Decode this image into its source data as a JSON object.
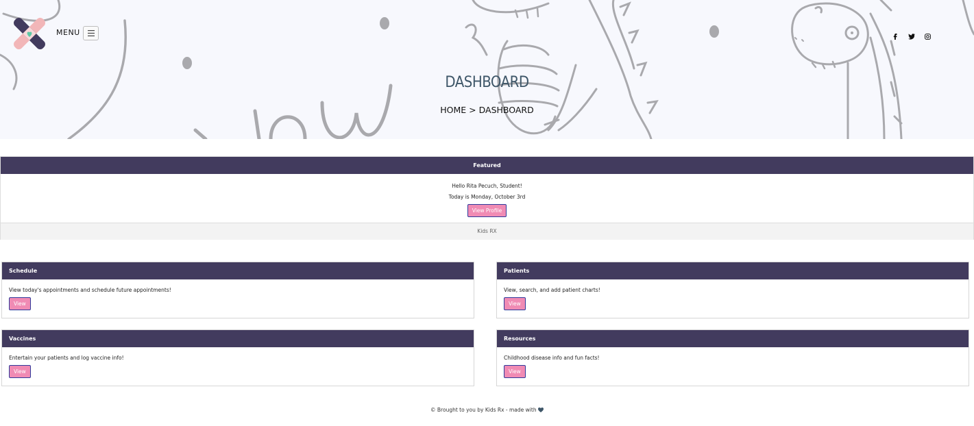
{
  "header": {
    "menu_label": "MENU",
    "menu_icon": "hamburger-icon",
    "social": [
      "facebook-icon",
      "twitter-icon",
      "instagram-icon"
    ]
  },
  "hero": {
    "title": "DASHBOARD",
    "breadcrumb": "HOME > DASHBOARD"
  },
  "featured": {
    "header": "Featured",
    "greeting": "Hello Rita Pecuch, Student!",
    "date": "Today is Monday, October 3rd",
    "button": "View Profile",
    "footer": "Kids RX"
  },
  "cards": [
    {
      "title": "Schedule",
      "text": "View today's appointments and schedule future appointments!",
      "button": "View"
    },
    {
      "title": "Patients",
      "text": "View, search, and add patient charts!",
      "button": "View"
    },
    {
      "title": "Vaccines",
      "text": "Entertain your patients and log vaccine info!",
      "button": "View"
    },
    {
      "title": "Resources",
      "text": "Childhood disease info and fun facts!",
      "button": "View"
    }
  ],
  "footer": {
    "text": "© Brought to you by Kids Rx - made with",
    "heart": "heart-icon"
  },
  "colors": {
    "accent_dark": "#423b5e",
    "button_pink": "#f08bb4",
    "hero_bg": "#f7f8fd",
    "title_color": "#3e5668"
  }
}
